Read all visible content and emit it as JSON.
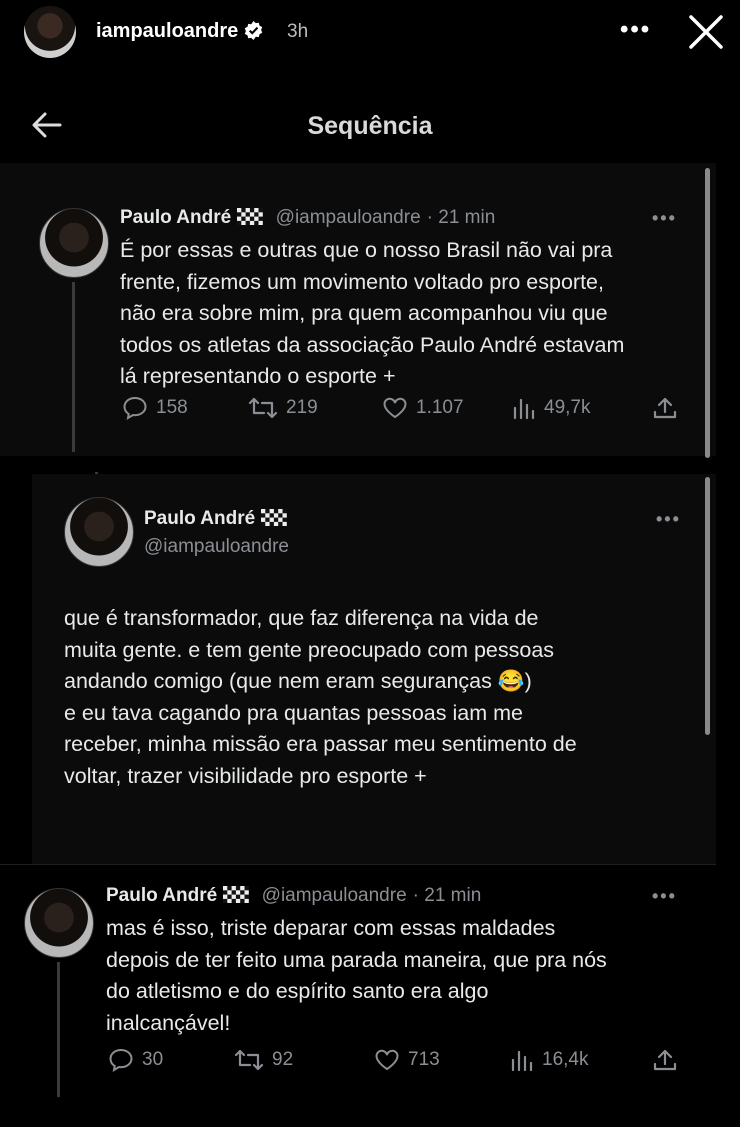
{
  "story": {
    "username": "iampauloandre",
    "time": "3h"
  },
  "page": {
    "title": "Sequência"
  },
  "tweets": [
    {
      "name": "Paulo André",
      "handle": "@iampauloandre",
      "time": "· 21 min",
      "text": "É por essas e outras que o nosso Brasil não vai pra\nfrente, fizemos um movimento voltado pro esporte,\nnão era sobre mim, pra quem acompanhou viu que\ntodos os atletas da associação Paulo André estavam\nlá representando o esporte +",
      "replies": "158",
      "retweets": "219",
      "likes": "1.107",
      "views": "49,7k"
    },
    {
      "name": "Paulo André",
      "handle": "@iampauloandre",
      "text": "que é transformador, que faz diferença na vida de\nmuita gente. e tem gente preocupado com pessoas\nandando comigo (que nem eram seguranças 😂)\ne eu tava cagando pra quantas pessoas iam me\nreceber, minha missão era passar meu sentimento de\nvoltar, trazer visibilidade pro esporte +"
    },
    {
      "name": "Paulo André",
      "handle": "@iampauloandre",
      "time": "· 21 min",
      "text": "mas é isso, triste deparar com essas maldades\ndepois de ter feito uma parada maneira, que pra nós\ndo atletismo e do espírito santo era algo\ninalcançável!",
      "replies": "30",
      "retweets": "92",
      "likes": "713",
      "views": "16,4k"
    }
  ],
  "icons": {
    "verified_color": "#ffffff",
    "accent": "#8b8f94"
  }
}
